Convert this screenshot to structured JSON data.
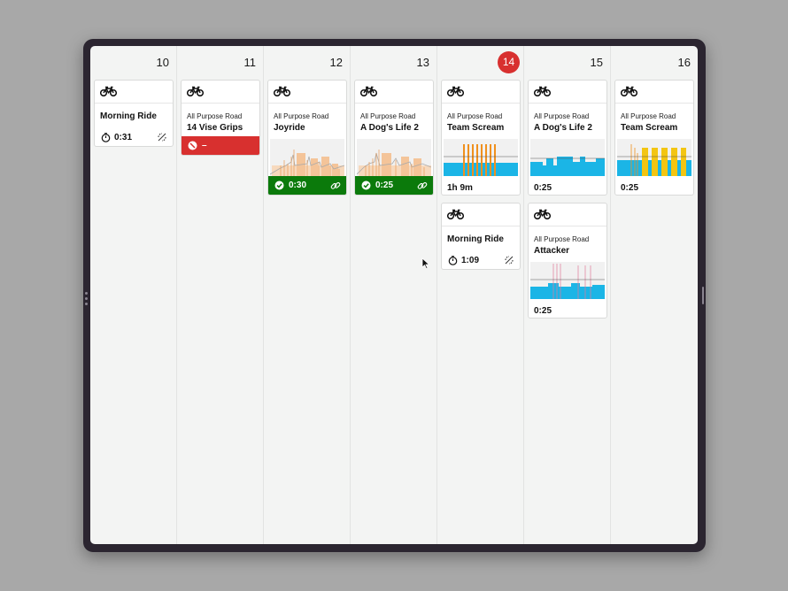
{
  "days": [
    "10",
    "11",
    "12",
    "13",
    "14",
    "15",
    "16"
  ],
  "today": "14",
  "cards": {
    "d10_ride": {
      "title": "Morning Ride",
      "duration": "0:31"
    },
    "d11_workout": {
      "category": "All Purpose Road",
      "title": "14 Vise Grips",
      "status_value": "–",
      "status": "skipped"
    },
    "d12_workout": {
      "category": "All Purpose Road",
      "title": "Joyride",
      "status_value": "0:30",
      "status": "completed"
    },
    "d13_workout": {
      "category": "All Purpose Road",
      "title": "A Dog's Life 2",
      "status_value": "0:25",
      "status": "completed"
    },
    "d14_workout": {
      "category": "All Purpose Road",
      "title": "Team Scream",
      "duration": "1h 9m"
    },
    "d14_ride": {
      "title": "Morning Ride",
      "duration": "1:09"
    },
    "d15_workout": {
      "category": "All Purpose Road",
      "title": "A Dog's Life 2",
      "duration": "0:25"
    },
    "d15_workout2": {
      "category": "All Purpose Road",
      "title": "Attacker",
      "duration": "0:25"
    },
    "d16_workout": {
      "category": "All Purpose Road",
      "title": "Team Scream",
      "duration": "0:25"
    }
  },
  "colors": {
    "completed": "#0b7a0b",
    "skipped": "#d8302f",
    "today": "#d8302f",
    "interval_blue": "#1bb5e6",
    "interval_orange": "#f0901e",
    "interval_yellow": "#f3c512",
    "faded_orange": "#f4c499"
  },
  "icons": [
    "bike-icon",
    "timer-icon",
    "unlinked-icon",
    "check-circle-icon",
    "link-icon",
    "blocked-icon",
    "mouse-cursor-icon"
  ]
}
